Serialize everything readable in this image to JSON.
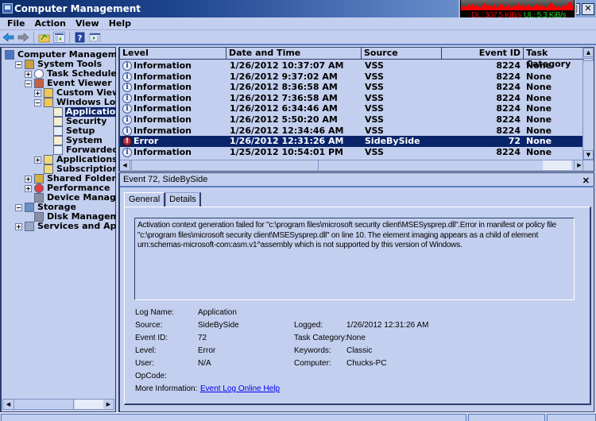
{
  "window": {
    "title": "Computer Management",
    "controls": {
      "maximize": "□",
      "close": "✕"
    }
  },
  "net_meter": {
    "download": "DL: 307.5 KiB/s",
    "upload": "UL: 5.3 KiB/s",
    "colors": {
      "download": "#ee0000",
      "upload": "#1ed01e"
    }
  },
  "menubar": {
    "items": [
      "File",
      "Action",
      "View",
      "Help"
    ]
  },
  "toolbar": {
    "icons": [
      "back-icon",
      "forward-icon",
      "up-folder-icon",
      "show-hide-tree-icon",
      "help-icon",
      "show-action-pane-icon"
    ]
  },
  "tree": {
    "nodes": [
      {
        "label": "Computer Management (",
        "icon": "computer-management-icon",
        "expander": ""
      },
      {
        "label": "System Tools",
        "icon": "tools-icon",
        "expander": "−"
      },
      {
        "label": "Task Scheduler",
        "icon": "clock-icon",
        "expander": "+"
      },
      {
        "label": "Event Viewer",
        "icon": "event-viewer-icon",
        "expander": "−"
      },
      {
        "label": "Custom Views",
        "icon": "folder-filter-icon",
        "expander": "+"
      },
      {
        "label": "Windows Logs",
        "icon": "folder-log-icon",
        "expander": "−"
      },
      {
        "label": "Application",
        "icon": "log-icon",
        "expander": "",
        "selected": true
      },
      {
        "label": "Security",
        "icon": "log-icon",
        "expander": ""
      },
      {
        "label": "Setup",
        "icon": "log-plain-icon",
        "expander": ""
      },
      {
        "label": "System",
        "icon": "log-icon",
        "expander": ""
      },
      {
        "label": "Forwarded E",
        "icon": "log-plain-icon",
        "expander": ""
      },
      {
        "label": "Applications and",
        "icon": "folder-icon",
        "expander": "+"
      },
      {
        "label": "Subscriptions",
        "icon": "subscriptions-icon",
        "expander": ""
      },
      {
        "label": "Shared Folders",
        "icon": "shared-folders-icon",
        "expander": "+"
      },
      {
        "label": "Performance",
        "icon": "performance-icon",
        "expander": "+"
      },
      {
        "label": "Device Manager",
        "icon": "device-manager-icon",
        "expander": ""
      },
      {
        "label": "Storage",
        "icon": "storage-icon",
        "expander": "−"
      },
      {
        "label": "Disk Management",
        "icon": "disk-icon",
        "expander": ""
      },
      {
        "label": "Services and Applicat",
        "icon": "services-icon",
        "expander": "+"
      }
    ]
  },
  "events": {
    "columns": [
      "Level",
      "Date and Time",
      "Source",
      "Event ID",
      "Task Category"
    ],
    "rows": [
      {
        "level": "Information",
        "datetime": "1/26/2012 10:37:07 AM",
        "source": "VSS",
        "event_id": "8224",
        "task_category": "None"
      },
      {
        "level": "Information",
        "datetime": "1/26/2012 9:37:02 AM",
        "source": "VSS",
        "event_id": "8224",
        "task_category": "None"
      },
      {
        "level": "Information",
        "datetime": "1/26/2012 8:36:58 AM",
        "source": "VSS",
        "event_id": "8224",
        "task_category": "None"
      },
      {
        "level": "Information",
        "datetime": "1/26/2012 7:36:58 AM",
        "source": "VSS",
        "event_id": "8224",
        "task_category": "None"
      },
      {
        "level": "Information",
        "datetime": "1/26/2012 6:34:46 AM",
        "source": "VSS",
        "event_id": "8224",
        "task_category": "None"
      },
      {
        "level": "Information",
        "datetime": "1/26/2012 5:50:20 AM",
        "source": "VSS",
        "event_id": "8224",
        "task_category": "None"
      },
      {
        "level": "Information",
        "datetime": "1/26/2012 12:34:46 AM",
        "source": "VSS",
        "event_id": "8224",
        "task_category": "None"
      },
      {
        "level": "Error",
        "datetime": "1/26/2012 12:31:26 AM",
        "source": "SideBySide",
        "event_id": "72",
        "task_category": "None",
        "selected": true
      },
      {
        "level": "Information",
        "datetime": "1/25/2012 10:54:01 PM",
        "source": "VSS",
        "event_id": "8224",
        "task_category": "None"
      }
    ]
  },
  "detail": {
    "title": "Event 72, SideBySide",
    "tabs": [
      "General",
      "Details"
    ],
    "active_tab": "General",
    "message": "Activation context generation failed for \"c:\\program files\\microsoft security client\\MSESysprep.dll\".Error in manifest or policy file \"c:\\program files\\microsoft security client\\MSESysprep.dll\" on line 10. The element imaging appears as a child of element urn:schemas-microsoft-com:asm.v1^assembly which is not supported by this version of Windows.",
    "props": {
      "log_name": {
        "label": "Log Name:",
        "value": "Application"
      },
      "source": {
        "label": "Source:",
        "value": "SideBySide"
      },
      "event_id": {
        "label": "Event ID:",
        "value": "72"
      },
      "level": {
        "label": "Level:",
        "value": "Error"
      },
      "user": {
        "label": "User:",
        "value": "N/A"
      },
      "opcode": {
        "label": "OpCode:",
        "value": ""
      },
      "more_info": {
        "label": "More Information:",
        "value": "Event Log Online Help"
      },
      "logged": {
        "label": "Logged:",
        "value": "1/26/2012 12:31:26 AM"
      },
      "task_category": {
        "label": "Task Category:",
        "value": "None"
      },
      "keywords": {
        "label": "Keywords:",
        "value": "Classic"
      },
      "computer": {
        "label": "Computer:",
        "value": "Chucks-PC"
      }
    }
  }
}
